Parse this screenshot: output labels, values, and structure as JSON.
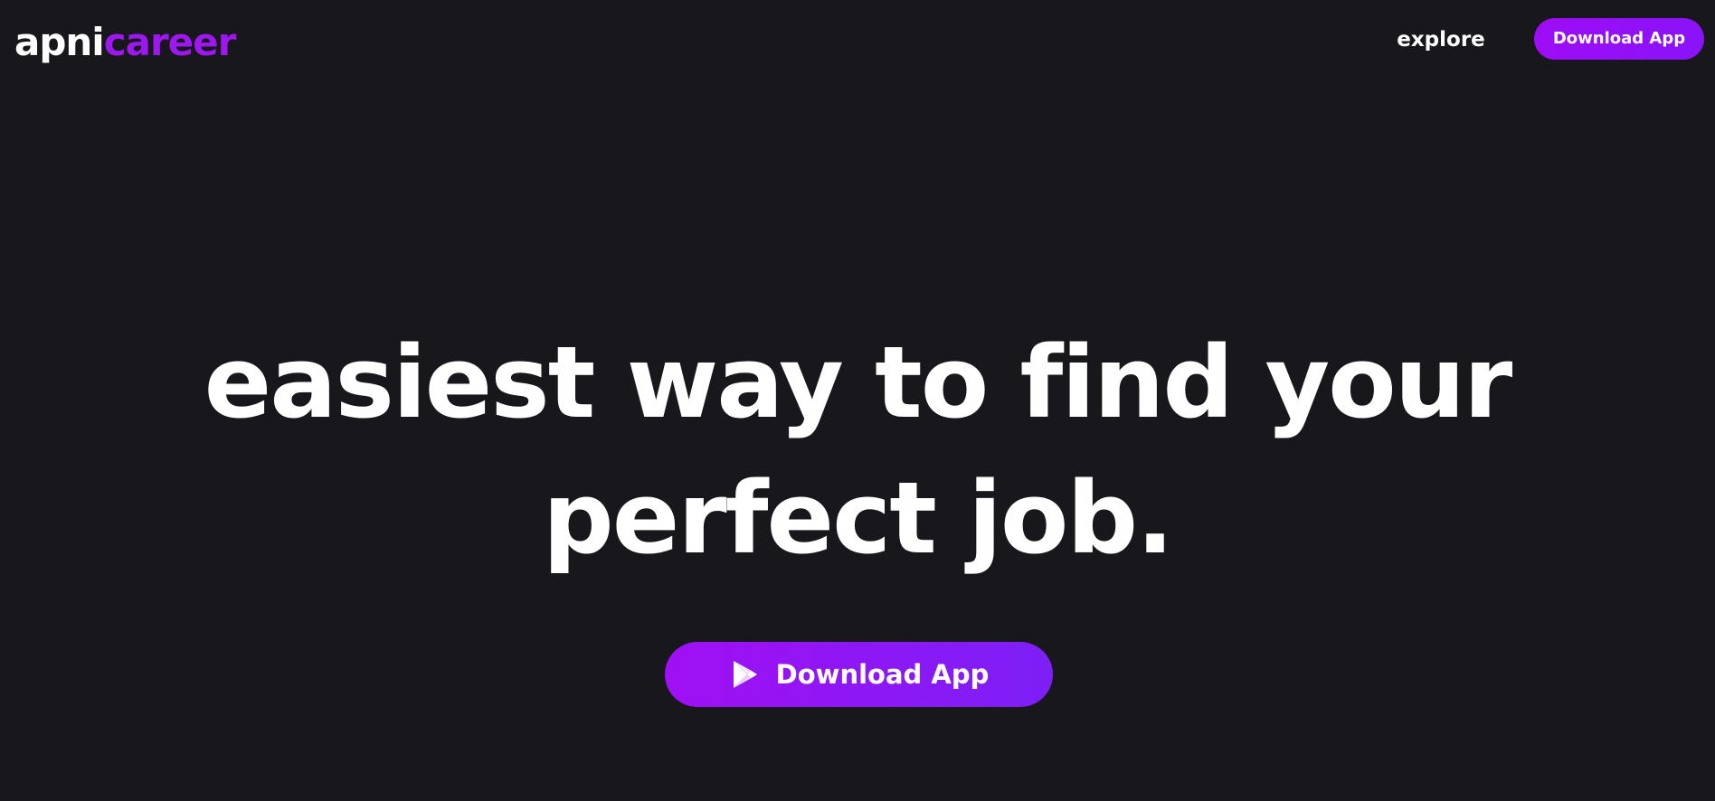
{
  "header": {
    "logo": {
      "part1": "apni",
      "part2": "career"
    },
    "nav": {
      "explore_label": "explore",
      "download_label": "Download App"
    }
  },
  "hero": {
    "title_line1": "easiest way to find your",
    "title_line2": "perfect job.",
    "cta_label": "Download App",
    "cta_icon": "google-play-icon"
  },
  "colors": {
    "background": "#18171c",
    "accent": "#9d17ef",
    "text": "#ffffff"
  }
}
